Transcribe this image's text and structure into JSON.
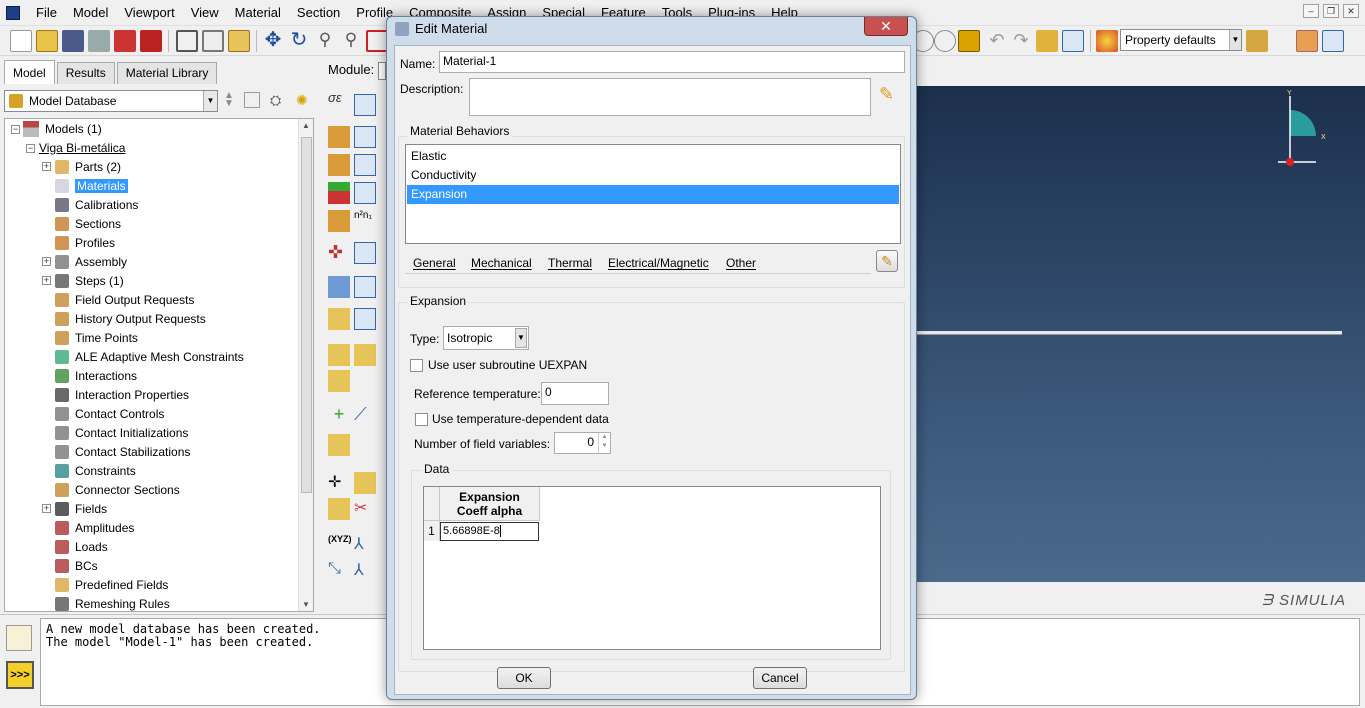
{
  "menu": {
    "items": [
      "File",
      "Model",
      "Viewport",
      "View",
      "Material",
      "Section",
      "Profile",
      "Composite",
      "Assign",
      "Special",
      "Feature",
      "Tools",
      "Plug-ins",
      "Help"
    ]
  },
  "toolbar": {
    "property_combo": "Property defaults"
  },
  "left_pane": {
    "tabs": [
      "Model",
      "Results",
      "Material Library"
    ],
    "active_tab": "Model",
    "db_combo": "Model Database",
    "tree": {
      "root": "Models (1)",
      "model": "Viga Bi-metálica",
      "items": [
        {
          "label": "Parts (2)",
          "expandable": true,
          "icon": "parts-icon"
        },
        {
          "label": "Materials",
          "expandable": false,
          "icon": "materials-icon",
          "selected": true
        },
        {
          "label": "Calibrations",
          "expandable": false,
          "icon": "calibrations-icon"
        },
        {
          "label": "Sections",
          "expandable": false,
          "icon": "sections-icon"
        },
        {
          "label": "Profiles",
          "expandable": false,
          "icon": "profiles-icon"
        },
        {
          "label": "Assembly",
          "expandable": true,
          "icon": "assembly-icon"
        },
        {
          "label": "Steps (1)",
          "expandable": true,
          "icon": "steps-icon"
        },
        {
          "label": "Field Output Requests",
          "expandable": false,
          "icon": "field-output-icon"
        },
        {
          "label": "History Output Requests",
          "expandable": false,
          "icon": "history-output-icon"
        },
        {
          "label": "Time Points",
          "expandable": false,
          "icon": "time-points-icon"
        },
        {
          "label": "ALE Adaptive Mesh Constraints",
          "expandable": false,
          "icon": "ale-icon"
        },
        {
          "label": "Interactions",
          "expandable": false,
          "icon": "interactions-icon"
        },
        {
          "label": "Interaction Properties",
          "expandable": false,
          "icon": "interaction-properties-icon"
        },
        {
          "label": "Contact Controls",
          "expandable": false,
          "icon": "contact-controls-icon"
        },
        {
          "label": "Contact Initializations",
          "expandable": false,
          "icon": "contact-init-icon"
        },
        {
          "label": "Contact Stabilizations",
          "expandable": false,
          "icon": "contact-stab-icon"
        },
        {
          "label": "Constraints",
          "expandable": false,
          "icon": "constraints-icon"
        },
        {
          "label": "Connector Sections",
          "expandable": false,
          "icon": "connector-icon"
        },
        {
          "label": "Fields",
          "expandable": true,
          "icon": "fields-icon"
        },
        {
          "label": "Amplitudes",
          "expandable": false,
          "icon": "amplitudes-icon"
        },
        {
          "label": "Loads",
          "expandable": false,
          "icon": "loads-icon"
        },
        {
          "label": "BCs",
          "expandable": false,
          "icon": "bcs-icon"
        },
        {
          "label": "Predefined Fields",
          "expandable": false,
          "icon": "predefined-icon"
        },
        {
          "label": "Remeshing Rules",
          "expandable": false,
          "icon": "remeshing-icon"
        }
      ]
    }
  },
  "module_label": "Module:",
  "viewport": {
    "brand": "SIMULIA",
    "triad": {
      "y": "Y",
      "x": "X"
    }
  },
  "messages": [
    "A new model database has been created.",
    "The model \"Model-1\" has been created."
  ],
  "dialog": {
    "title": "Edit Material",
    "close": "✕",
    "name_label": "Name:",
    "name_value": "Material-1",
    "description_label": "Description:",
    "description_value": "",
    "behaviors_title": "Material Behaviors",
    "behaviors": [
      "Elastic",
      "Conductivity",
      "Expansion"
    ],
    "selected_behavior": "Expansion",
    "menus": [
      "General",
      "Mechanical",
      "Thermal",
      "Electrical/Magnetic",
      "Other"
    ],
    "section_title": "Expansion",
    "type_label": "Type:",
    "type_value": "Isotropic",
    "subroutine_label": "Use user subroutine UEXPAN",
    "ref_temp_label": "Reference temperature:",
    "ref_temp_value": "0",
    "temp_dep_label": "Use temperature-dependent data",
    "field_vars_label": "Number of field variables:",
    "field_vars_value": "0",
    "data_title": "Data",
    "table": {
      "header_line1": "Expansion",
      "header_line2": "Coeff alpha",
      "rows": [
        {
          "index": "1",
          "value": "5.66898E-8"
        }
      ]
    },
    "ok": "OK",
    "cancel": "Cancel"
  },
  "colors": {
    "selection": "#3399ff",
    "viewport_top": "#1c2f4d",
    "viewport_bottom": "#4d6d8e",
    "dialog_frame": "#cfdcea",
    "close_button": "#c75050"
  }
}
